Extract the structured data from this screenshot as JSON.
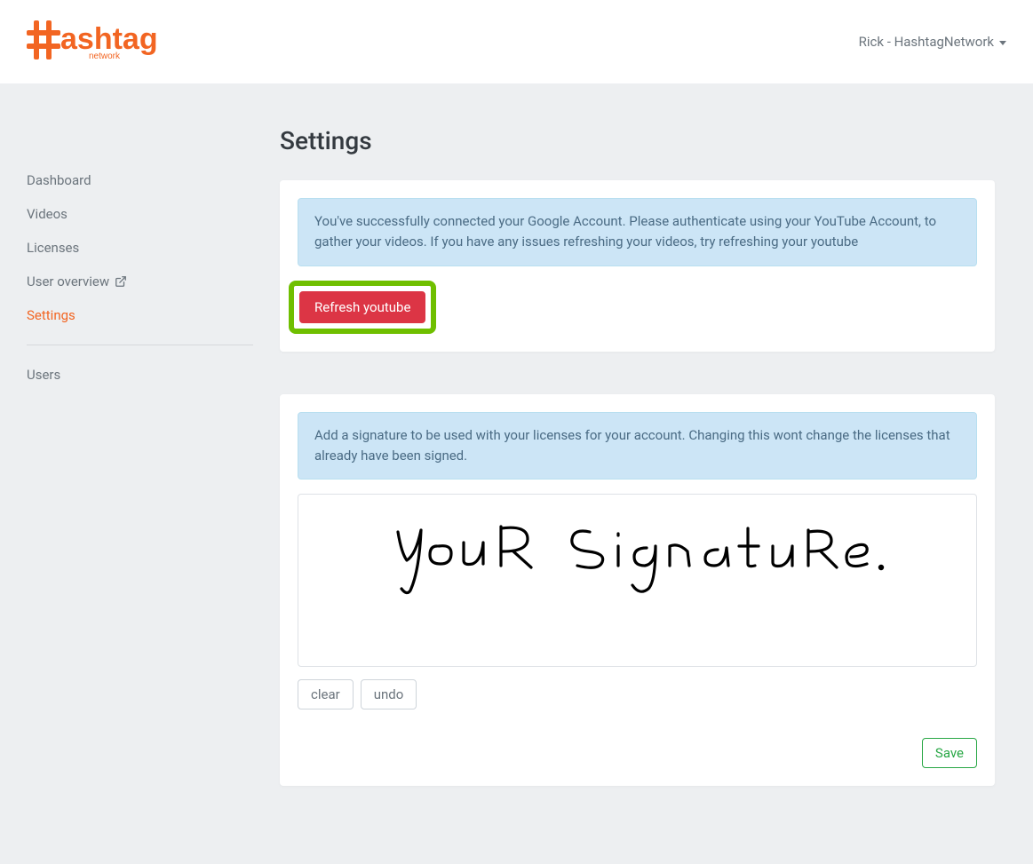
{
  "header": {
    "logo_main": "ashtag",
    "logo_sub": "network",
    "user_label": "Rick - HashtagNetwork"
  },
  "sidebar": {
    "items": [
      {
        "label": "Dashboard",
        "external": false,
        "active": false
      },
      {
        "label": "Videos",
        "external": false,
        "active": false
      },
      {
        "label": "Licenses",
        "external": false,
        "active": false
      },
      {
        "label": "User overview",
        "external": true,
        "active": false
      },
      {
        "label": "Settings",
        "external": false,
        "active": true
      }
    ],
    "secondary": [
      {
        "label": "Users",
        "external": false,
        "active": false
      }
    ]
  },
  "page": {
    "title": "Settings",
    "youtube_card": {
      "alert_text": "You've successfully connected your Google Account. Please authenticate using your YouTube Account, to gather your videos. If you have any issues refreshing your videos, try refreshing your youtube",
      "refresh_button": "Refresh youtube"
    },
    "signature_card": {
      "alert_text": "Add a signature to be used with your licenses for your account. Changing this wont change the licenses that already have been signed.",
      "canvas_placeholder": "your signature.",
      "clear_button": "clear",
      "undo_button": "undo",
      "save_button": "Save"
    }
  }
}
